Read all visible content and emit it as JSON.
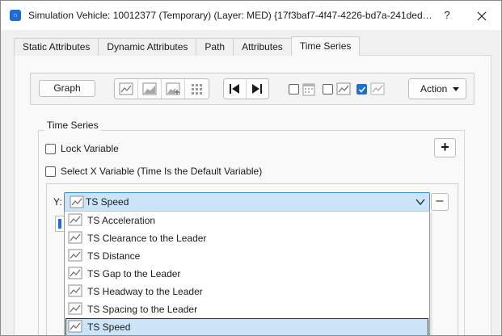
{
  "window": {
    "title": "Simulation Vehicle: 10012377 (Temporary) (Layer: MED) {17f3baf7-4f47-4226-bd7a-241deda...",
    "help_label": "?",
    "app_icon_glyph": "∩",
    "accent_color": "#1f6fd1"
  },
  "tabs": [
    {
      "label": "Static Attributes"
    },
    {
      "label": "Dynamic Attributes"
    },
    {
      "label": "Path"
    },
    {
      "label": "Attributes"
    },
    {
      "label": "Time Series",
      "active": true
    }
  ],
  "toolbar": {
    "graph_label": "Graph",
    "action_label": "Action",
    "chart_icons": [
      "line-chart-icon",
      "area-chart-icon",
      "add-chart-icon",
      "grid-icon"
    ],
    "nav_icons": [
      "first-icon",
      "last-icon"
    ],
    "toggles": [
      {
        "icon": "calendar-icon",
        "checked": false
      },
      {
        "icon": "line-chart-icon",
        "checked": false
      },
      {
        "icon": "line-chart-icon",
        "checked": true
      }
    ]
  },
  "time_series": {
    "group_label": "Time Series",
    "lock_variable_label": "Lock Variable",
    "lock_variable_checked": false,
    "select_x_label": "Select X Variable (Time Is the Default Variable)",
    "select_x_checked": false,
    "add_label": "+",
    "remove_label": "–",
    "y_label": "Y:",
    "selected": "TS Speed",
    "options": [
      "TS Acceleration",
      "TS Clearance to the Leader",
      "TS Distance",
      "TS Gap to the Leader",
      "TS Headway to the Leader",
      "TS Spacing to the Leader",
      "TS Speed"
    ]
  }
}
